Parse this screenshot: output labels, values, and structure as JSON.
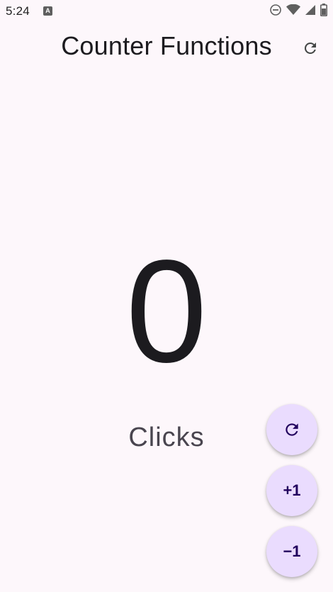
{
  "status_bar": {
    "time": "5:24",
    "notification_badge": "A",
    "icons": [
      "do-not-disturb-icon",
      "wifi-icon",
      "signal-icon",
      "battery-icon"
    ]
  },
  "app_bar": {
    "title": "Counter Functions",
    "action_icon": "refresh-icon"
  },
  "counter": {
    "value": "0",
    "label": "Clicks"
  },
  "fabs": {
    "reset_icon": "refresh-icon",
    "increment_label": "+1",
    "decrement_label": "−1"
  },
  "colors": {
    "background": "#fdf7fb",
    "fab_background": "#eadcfe",
    "fab_foreground": "#21005d",
    "text_primary": "#1c1b1f"
  }
}
